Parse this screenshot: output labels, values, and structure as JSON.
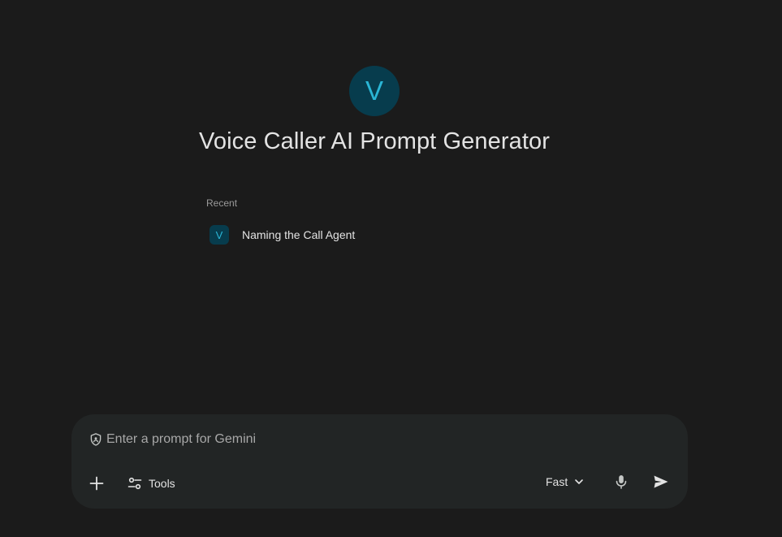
{
  "gem": {
    "avatar_letter": "V",
    "title": "Voice Caller AI Prompt Generator"
  },
  "recent": {
    "label": "Recent",
    "items": [
      {
        "avatar_letter": "V",
        "title": "Naming the Call Agent"
      }
    ]
  },
  "composer": {
    "placeholder": "Enter a prompt for Gemini",
    "tools_label": "Tools",
    "model_label": "Fast"
  },
  "icons": {
    "privacy": "shield-icon",
    "add": "plus-icon",
    "tools": "tune-icon",
    "model_menu": "chevron-down-icon",
    "voice": "mic-icon",
    "submit": "send-icon"
  },
  "colors": {
    "background": "#1b1b1b",
    "composer": "#222525",
    "avatar_bg": "#073c4d",
    "avatar_fg": "#2ab6d6"
  }
}
